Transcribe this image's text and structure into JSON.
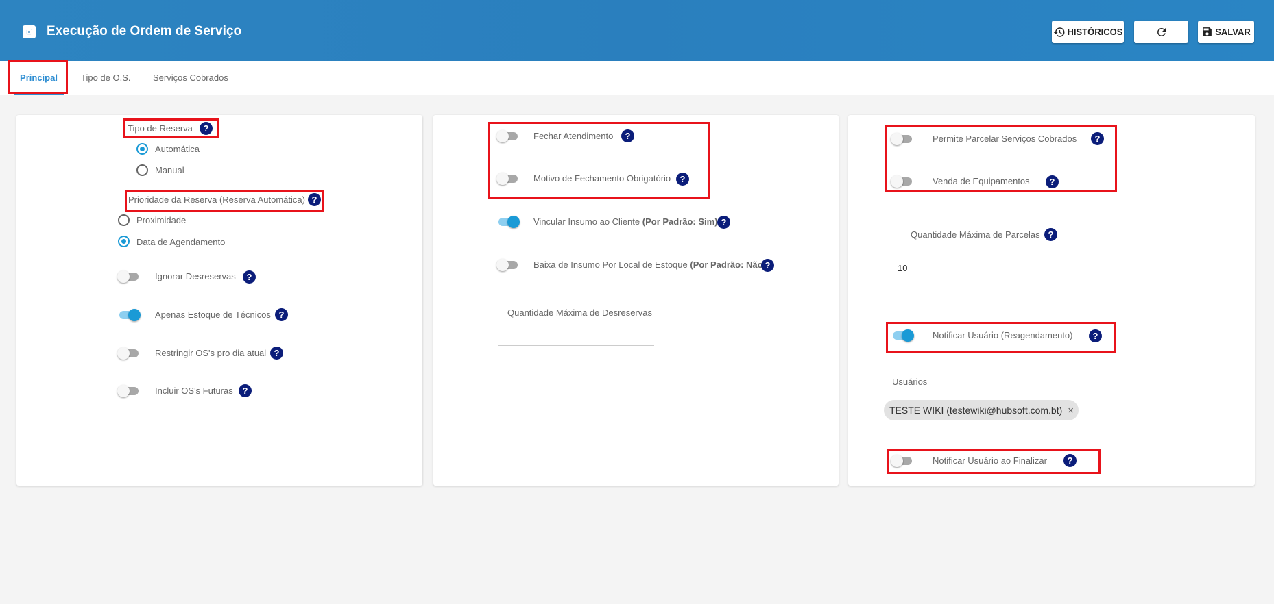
{
  "header": {
    "title": "Execução de Ordem de Serviço",
    "historicos_label": "HISTÓRICOS",
    "salvar_label": "SALVAR"
  },
  "tabs": [
    {
      "label": "Principal",
      "active": true
    },
    {
      "label": "Tipo de O.S.",
      "active": false
    },
    {
      "label": "Serviços Cobrados",
      "active": false
    }
  ],
  "col1": {
    "tipo_reserva_label": "Tipo de Reserva",
    "tipo_reserva_options": [
      {
        "label": "Automática",
        "selected": true
      },
      {
        "label": "Manual",
        "selected": false
      }
    ],
    "prioridade_label": "Prioridade da Reserva (Reserva Automática)",
    "prioridade_options": [
      {
        "label": "Proximidade",
        "selected": false
      },
      {
        "label": "Data de Agendamento",
        "selected": true
      }
    ],
    "toggles": [
      {
        "label": "Ignorar Desreservas",
        "on": false
      },
      {
        "label": "Apenas Estoque de Técnicos",
        "on": true
      },
      {
        "label": "Restringir OS's pro dia atual",
        "on": false
      },
      {
        "label": "Incluir OS's Futuras",
        "on": false
      }
    ]
  },
  "col2": {
    "toggles": [
      {
        "label": "Fechar Atendimento",
        "on": false
      },
      {
        "label": "Motivo de Fechamento Obrigatório",
        "on": false
      },
      {
        "label": "Vincular Insumo ao Cliente",
        "suffix": "(Por Padrão: Sim)",
        "on": true
      },
      {
        "label": "Baixa de Insumo Por Local de Estoque",
        "suffix": "(Por Padrão: Não)",
        "on": false
      }
    ],
    "qtd_max_desreservas_label": "Quantidade Máxima de Desreservas",
    "qtd_max_desreservas_value": ""
  },
  "col3": {
    "toggles": [
      {
        "label": "Permite Parcelar Serviços Cobrados",
        "on": false
      },
      {
        "label": "Venda de Equipamentos",
        "on": false
      }
    ],
    "qtd_max_parcelas_label": "Quantidade Máxima de Parcelas",
    "qtd_max_parcelas_value": "10",
    "notificar_reagendamento": {
      "label": "Notificar Usuário (Reagendamento)",
      "on": true
    },
    "usuarios_label": "Usuários",
    "usuarios_chips": [
      "TESTE WIKI (testewiki@hubsoft.com.bt)"
    ],
    "notificar_finalizar": {
      "label": "Notificar Usuário ao Finalizar",
      "on": false
    }
  },
  "help_glyph": "?",
  "chip_remove_glyph": "×",
  "colors": {
    "header_bg": "#2a7fbe",
    "accent": "#1a9ad6",
    "tab_active": "#2d8dd2",
    "highlight_box": "#e8131b",
    "help_icon": "#0b1d7a"
  }
}
